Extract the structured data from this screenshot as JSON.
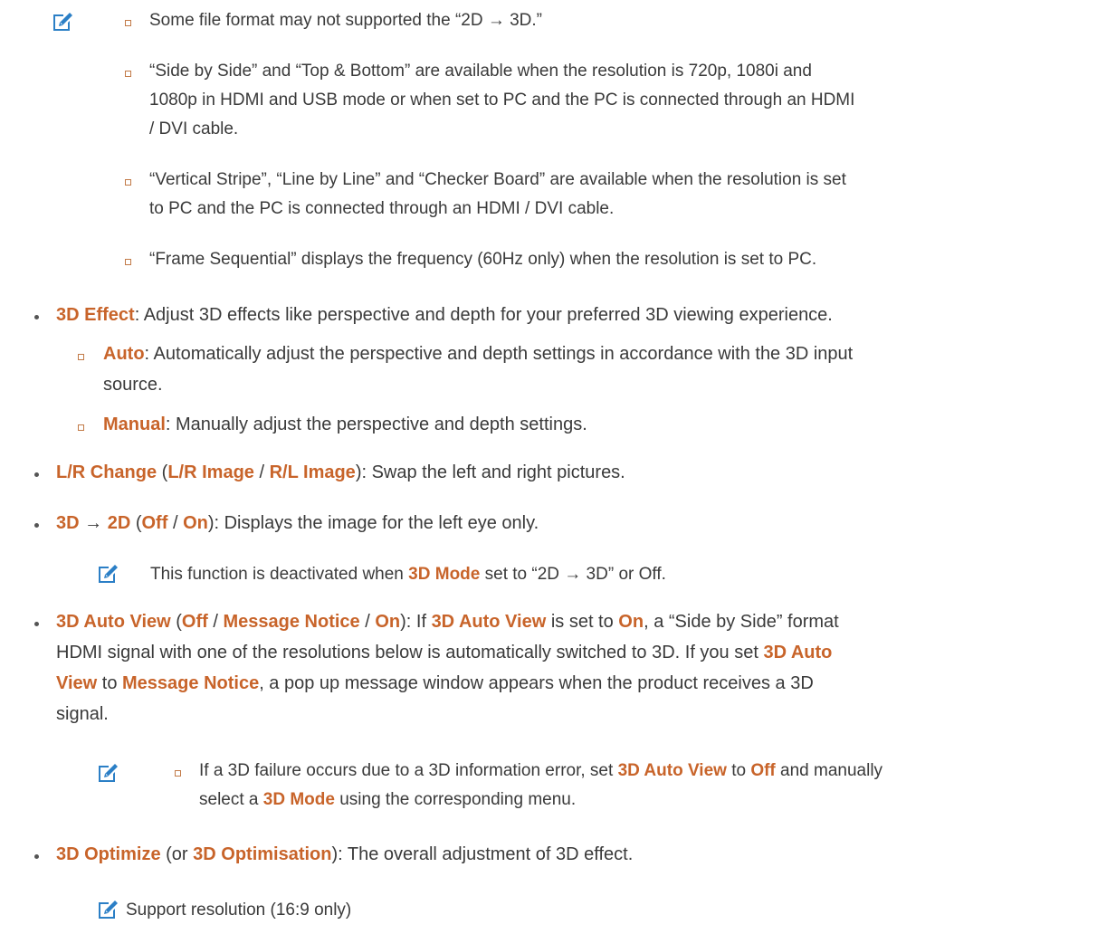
{
  "notes_first": {
    "items": [
      "Some file format may not supported the “2D → 3D.”",
      "“Side by Side” and “Top & Bottom” are available when the resolution is 720p, 1080i and",
      "1080p in HDMI and USB mode or when set to PC and the PC is connected through an HDMI",
      "/ DVI cable.",
      "“Vertical Stripe”, “Line by Line” and “Checker Board” are available when the resolution is set",
      "to PC and the PC is connected through an HDMI / DVI cable.",
      "“Frame Sequential” displays the frequency (60Hz only) when the resolution is set to PC."
    ]
  },
  "effect": {
    "label": "3D Effect",
    "text": ": Adjust 3D effects like perspective and depth for your preferred 3D viewing experience.",
    "auto_label": "Auto",
    "auto_text_1": ": Automatically adjust the perspective and depth settings in accordance with the 3D input",
    "auto_text_2": "source.",
    "manual_label": "Manual",
    "manual_text": ": Manually adjust the perspective and depth settings."
  },
  "lr_change": {
    "label": "L/R Change",
    "opt1": "L/R Image",
    "opt2": "R/L Image",
    "text": "): Swap the left and right pictures."
  },
  "to2d": {
    "label_a": "3D",
    "arrow": " → ",
    "label_b": "2D",
    "off": "Off",
    "on": "On",
    "text": "): Displays the image for the left eye only.",
    "note_pre": "This function is deactivated when ",
    "note_label": "3D Mode",
    "note_post": " set to “2D → 3D” or Off."
  },
  "auto_view": {
    "label": "3D Auto View",
    "off": "Off",
    "msg": "Message Notice",
    "on": "On",
    "t1": "): If ",
    "t2": " is set to ",
    "t3": ", a “Side by Side” format",
    "line2": "HDMI signal with one of the resolutions below is automatically switched to 3D. If you set ",
    "label_part1": "3D Auto",
    "label_part2": "View",
    "t4": " to ",
    "t5": ", a pop up message window appears when the product receives a 3D",
    "line4": "signal.",
    "note1_pre": "If a 3D failure occurs due to a 3D information error, set ",
    "note1_mid": " to ",
    "note1_post": " and manually",
    "note2_pre": "select a ",
    "note2_label": "3D Mode",
    "note2_post": " using the corresponding menu."
  },
  "optimize": {
    "label": "3D Optimize",
    "pre": " (or ",
    "alt": "3D Optimisation",
    "text": "): The overall adjustment of 3D effect.",
    "note": "Support resolution (16:9 only)"
  },
  "colors": {
    "highlight": "#c8642a",
    "text": "#3a3a3a",
    "note_icon": "#2b7fc6"
  },
  "icons": {
    "note": "note-pencil-icon",
    "sub_bullet": "square-bullet-icon",
    "bullet": "dot-bullet-icon"
  }
}
